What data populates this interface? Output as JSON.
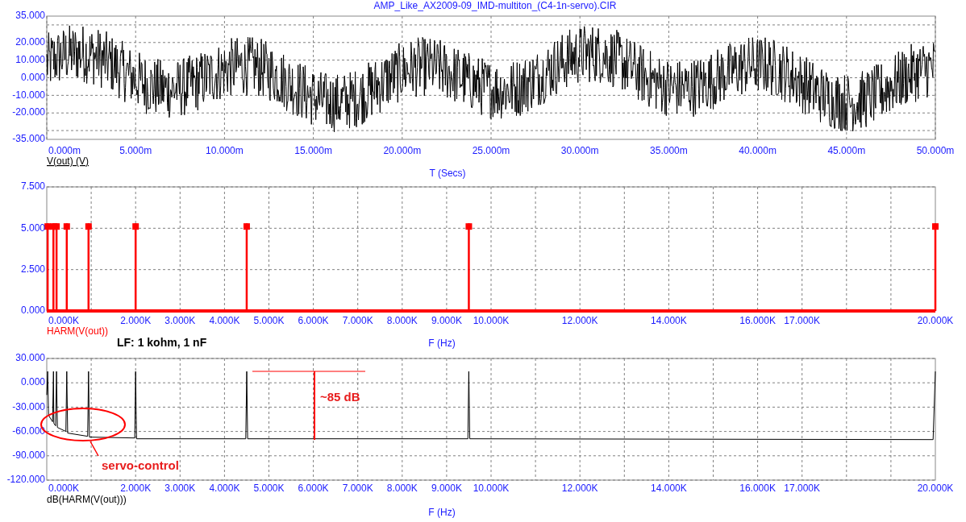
{
  "title": "AMP_Like_AX2009-09_IMD-multiton_(C4-1n-servo).CIR",
  "panels": [
    {
      "kind": "waveform",
      "y_tick_labels": [
        "35.000",
        "20.000",
        "10.000",
        "0.000",
        "-10.000",
        "-20.000",
        "-35.000"
      ],
      "x_tick_labels": [
        "0.000m",
        "5.000m",
        "10.000m",
        "15.000m",
        "20.000m",
        "25.000m",
        "30.000m",
        "35.000m",
        "40.000m",
        "45.000m",
        "50.000m"
      ],
      "trace_label": "V(out) (V)",
      "x_axis_title": "T (Secs)"
    },
    {
      "kind": "stems",
      "note": "LF: 1 kohm, 1 nF",
      "chart_data": {
        "type": "bar",
        "xlabel": "F (Hz)",
        "grid": true,
        "x": [
          20,
          150,
          220,
          450,
          940,
          2000,
          4500,
          9500,
          20000
        ],
        "series": [
          {
            "name": "HARM(V(out))",
            "color": "#ff0000",
            "values": [
              5.3,
              5.3,
              5.3,
              5.3,
              5.3,
              5.3,
              5.3,
              5.3,
              5.3
            ]
          }
        ],
        "xlim": [
          0,
          20000
        ],
        "ylim": [
          0,
          7.5
        ],
        "yticks": [
          {
            "value": 7.5,
            "label": "7.500"
          },
          {
            "value": 5,
            "label": "5.000"
          },
          {
            "value": 2.5,
            "label": "2.500"
          },
          {
            "value": 0,
            "label": "0.000"
          }
        ],
        "xticks": [
          {
            "value": 0,
            "label": "0.000K"
          },
          {
            "value": 2000,
            "label": "2.000K"
          },
          {
            "value": 3000,
            "label": "3.000K"
          },
          {
            "value": 4000,
            "label": "4.000K"
          },
          {
            "value": 5000,
            "label": "5.000K"
          },
          {
            "value": 6000,
            "label": "6.000K"
          },
          {
            "value": 7000,
            "label": "7.000K"
          },
          {
            "value": 8000,
            "label": "8.000K"
          },
          {
            "value": 9000,
            "label": "9.000K"
          },
          {
            "value": 10000,
            "label": "10.000K"
          },
          {
            "value": 12000,
            "label": "12.000K"
          },
          {
            "value": 14000,
            "label": "14.000K"
          },
          {
            "value": 16000,
            "label": "16.000K"
          },
          {
            "value": 17000,
            "label": "17.000K"
          },
          {
            "value": 20000,
            "label": "20.000K"
          }
        ]
      }
    },
    {
      "kind": "spectrum",
      "chart_data": {
        "type": "line",
        "xlabel": "F (Hz)",
        "grid": true,
        "x": [
          0,
          20,
          40,
          130,
          150,
          160,
          200,
          220,
          240,
          430,
          450,
          470,
          920,
          940,
          960,
          1980,
          2000,
          2020,
          4480,
          4500,
          4520,
          9480,
          9500,
          9520,
          19950,
          20000
        ],
        "series": [
          {
            "name": "dB(HARM(V(out)))",
            "color": "#000000",
            "values": [
              -15,
              14,
              -40,
              -48,
              14,
              -50,
              -53,
              14,
              -55,
              -60,
              14,
              -62,
              -66,
              14,
              -67,
              -68,
              14,
              -69,
              -69,
              14,
              -69,
              -69,
              14,
              -69,
              -70,
              14
            ]
          }
        ],
        "xlim": [
          0,
          20000
        ],
        "ylim": [
          -120,
          30
        ],
        "yticks": [
          {
            "value": 30,
            "label": "30.000"
          },
          {
            "value": 0,
            "label": "0.000"
          },
          {
            "value": -30,
            "label": "-30.000"
          },
          {
            "value": -60,
            "label": "-60.000"
          },
          {
            "value": -90,
            "label": "-90.000"
          },
          {
            "value": -120,
            "label": "-120.000"
          }
        ],
        "xticks": [
          {
            "value": 0,
            "label": "0.000K"
          },
          {
            "value": 2000,
            "label": "2.000K"
          },
          {
            "value": 3000,
            "label": "3.000K"
          },
          {
            "value": 4000,
            "label": "4.000K"
          },
          {
            "value": 5000,
            "label": "5.000K"
          },
          {
            "value": 6000,
            "label": "6.000K"
          },
          {
            "value": 7000,
            "label": "7.000K"
          },
          {
            "value": 8000,
            "label": "8.000K"
          },
          {
            "value": 9000,
            "label": "9.000K"
          },
          {
            "value": 10000,
            "label": "10.000K"
          },
          {
            "value": 12000,
            "label": "12.000K"
          },
          {
            "value": 14000,
            "label": "14.000K"
          },
          {
            "value": 16000,
            "label": "16.000K"
          },
          {
            "value": 17000,
            "label": "17.000K"
          },
          {
            "value": 20000,
            "label": "20.000K"
          }
        ],
        "annotations": [
          {
            "text": "~85 dB"
          },
          {
            "text": "servo-control"
          }
        ]
      }
    }
  ]
}
